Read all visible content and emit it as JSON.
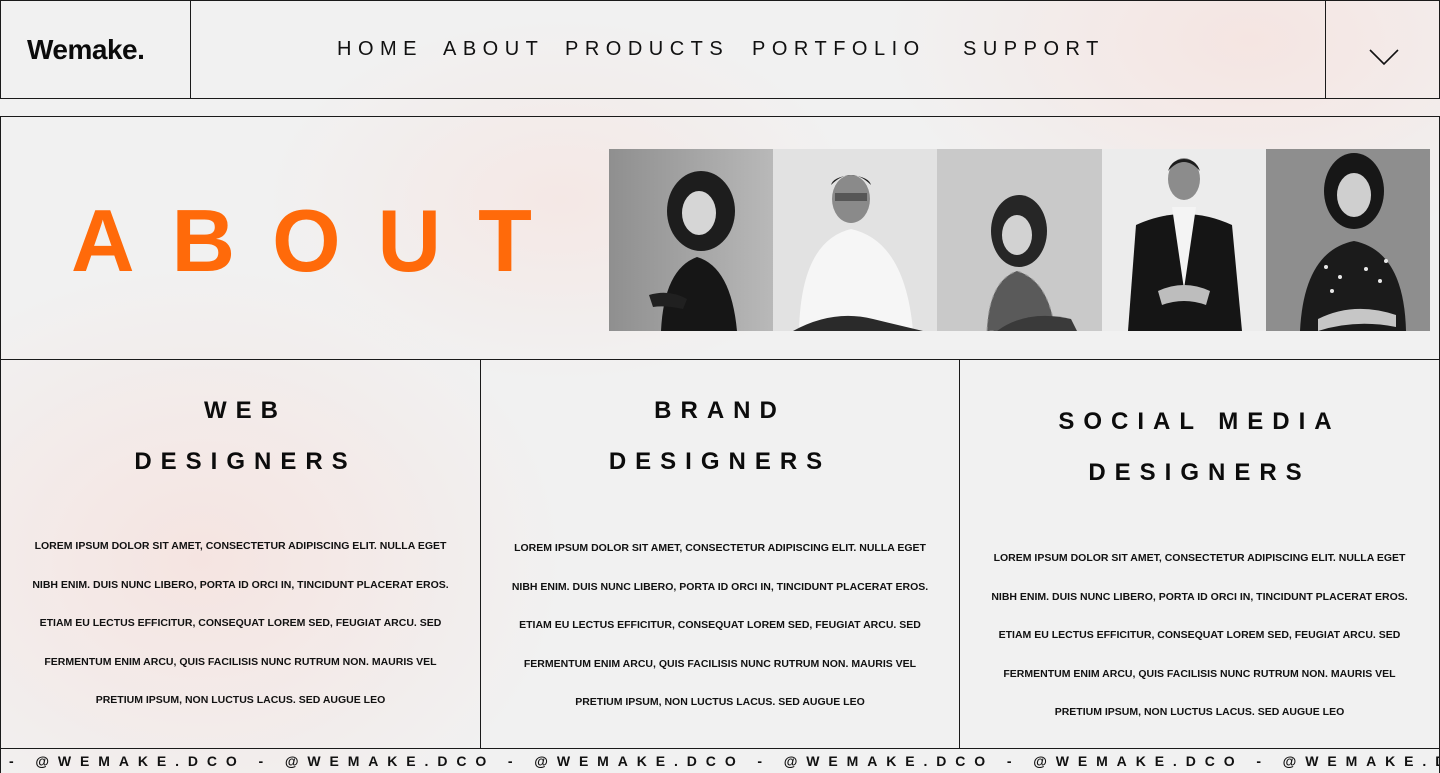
{
  "header": {
    "logo": "Wemake.",
    "nav": [
      {
        "label": "HOME",
        "name": "nav-home"
      },
      {
        "label": "ABOUT",
        "name": "nav-about"
      },
      {
        "label": "PRODUCTS",
        "name": "nav-products"
      },
      {
        "label": "PORTFOLIO",
        "name": "nav-portfolio"
      },
      {
        "label": "SUPPORT",
        "name": "nav-support"
      }
    ],
    "toggle_icon": "chevron-down-icon"
  },
  "hero": {
    "title": "ABOUT",
    "accent_color": "#ff6a0a",
    "team_photos": [
      {
        "description_icon": "team-member-photo",
        "tone": "grayscale"
      },
      {
        "description_icon": "team-member-photo",
        "tone": "grayscale"
      },
      {
        "description_icon": "team-member-photo",
        "tone": "grayscale"
      },
      {
        "description_icon": "team-member-photo",
        "tone": "grayscale"
      },
      {
        "description_icon": "team-member-photo",
        "tone": "grayscale"
      }
    ]
  },
  "columns": [
    {
      "title_line1": "WEB",
      "title_line2": "DESIGNERS",
      "body": [
        "LOREM IPSUM DOLOR SIT AMET, CONSECTETUR ADIPISCING ELIT. NULLA EGET",
        "NIBH ENIM. DUIS NUNC LIBERO, PORTA ID ORCI IN, TINCIDUNT PLACERAT EROS.",
        "ETIAM EU LECTUS EFFICITUR, CONSEQUAT LOREM SED, FEUGIAT ARCU. SED",
        "FERMENTUM ENIM ARCU, QUIS FACILISIS NUNC RUTRUM NON. MAURIS VEL",
        "PRETIUM IPSUM, NON LUCTUS LACUS. SED AUGUE LEO"
      ]
    },
    {
      "title_line1": "BRAND",
      "title_line2": "DESIGNERS",
      "body": [
        "LOREM IPSUM DOLOR SIT AMET, CONSECTETUR ADIPISCING ELIT. NULLA EGET",
        "NIBH ENIM. DUIS NUNC LIBERO, PORTA ID ORCI IN, TINCIDUNT PLACERAT EROS.",
        "ETIAM EU LECTUS EFFICITUR, CONSEQUAT LOREM SED, FEUGIAT ARCU. SED",
        "FERMENTUM ENIM ARCU, QUIS FACILISIS NUNC RUTRUM NON. MAURIS VEL",
        "PRETIUM IPSUM, NON LUCTUS LACUS. SED AUGUE LEO"
      ]
    },
    {
      "title_line1": "SOCIAL MEDIA",
      "title_line2": "DESIGNERS",
      "body": [
        "LOREM IPSUM DOLOR SIT AMET, CONSECTETUR ADIPISCING ELIT. NULLA EGET",
        "NIBH ENIM. DUIS NUNC LIBERO, PORTA ID ORCI IN, TINCIDUNT PLACERAT EROS.",
        "ETIAM EU LECTUS EFFICITUR, CONSEQUAT LOREM SED, FEUGIAT ARCU. SED",
        "FERMENTUM ENIM ARCU, QUIS FACILISIS NUNC RUTRUM NON. MAURIS VEL",
        "PRETIUM IPSUM, NON LUCTUS LACUS. SED AUGUE LEO"
      ]
    }
  ],
  "ticker": {
    "text": "- @WEMAKE.DCO - @WEMAKE.DCO - @WEMAKE.DCO - @WEMAKE.DCO - @WEMAKE.DCO - @WEMAKE.DCO - @WEMA"
  }
}
